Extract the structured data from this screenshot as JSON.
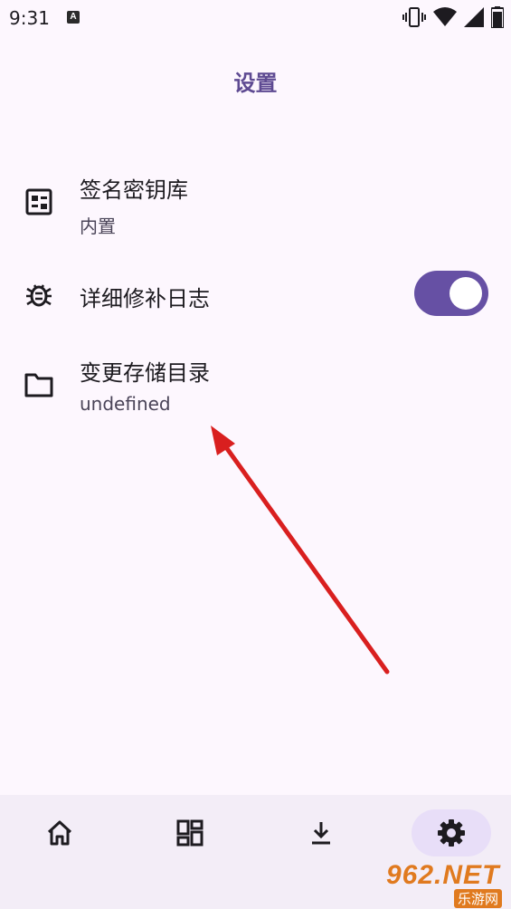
{
  "status_bar": {
    "time": "9:31",
    "notification_icon": "A",
    "icons": [
      "vibrate-icon",
      "wifi-icon",
      "signal-icon",
      "battery-icon"
    ]
  },
  "header": {
    "title": "设置"
  },
  "settings": {
    "keystore": {
      "title": "签名密钥库",
      "subtitle": "内置",
      "icon": "keystore-icon"
    },
    "verbose_log": {
      "title": "详细修补日志",
      "icon": "bug-icon",
      "enabled": true
    },
    "storage_dir": {
      "title": "变更存储目录",
      "subtitle": "undefined",
      "icon": "folder-icon"
    }
  },
  "bottom_nav": {
    "items": [
      {
        "icon": "home-icon",
        "active": false
      },
      {
        "icon": "dashboard-icon",
        "active": false
      },
      {
        "icon": "download-icon",
        "active": false
      },
      {
        "icon": "settings-gear-icon",
        "active": true
      }
    ]
  },
  "watermark": {
    "main": "962.NET",
    "sub": "乐游网"
  },
  "colors": {
    "accent": "#6650a4",
    "title": "#5e4a92",
    "background": "#fdf7fe",
    "nav_bg": "#f3edf7",
    "arrow": "#d91f1f"
  }
}
